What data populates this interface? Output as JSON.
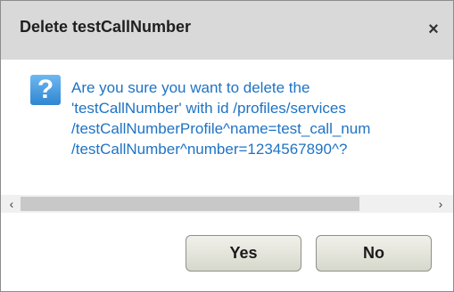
{
  "dialog": {
    "title": "Delete testCallNumber",
    "close_icon": "×",
    "question_icon": "?",
    "message_lines": [
      "Are you sure you want to delete the",
      "'testCallNumber' with id /profiles/services",
      "/testCallNumberProfile^name=test_call_num",
      "/testCallNumber^number=1234567890^?"
    ],
    "scrollbar": {
      "left_arrow": "‹",
      "right_arrow": "›"
    },
    "buttons": {
      "yes_label": "Yes",
      "no_label": "No"
    }
  },
  "colors": {
    "titlebar_bg": "#d9d9d9",
    "message_text": "#1f73c4",
    "button_bg": "#e4e5da"
  },
  "icons": [
    "close-icon",
    "question-icon",
    "scroll-left-icon",
    "scroll-right-icon"
  ]
}
